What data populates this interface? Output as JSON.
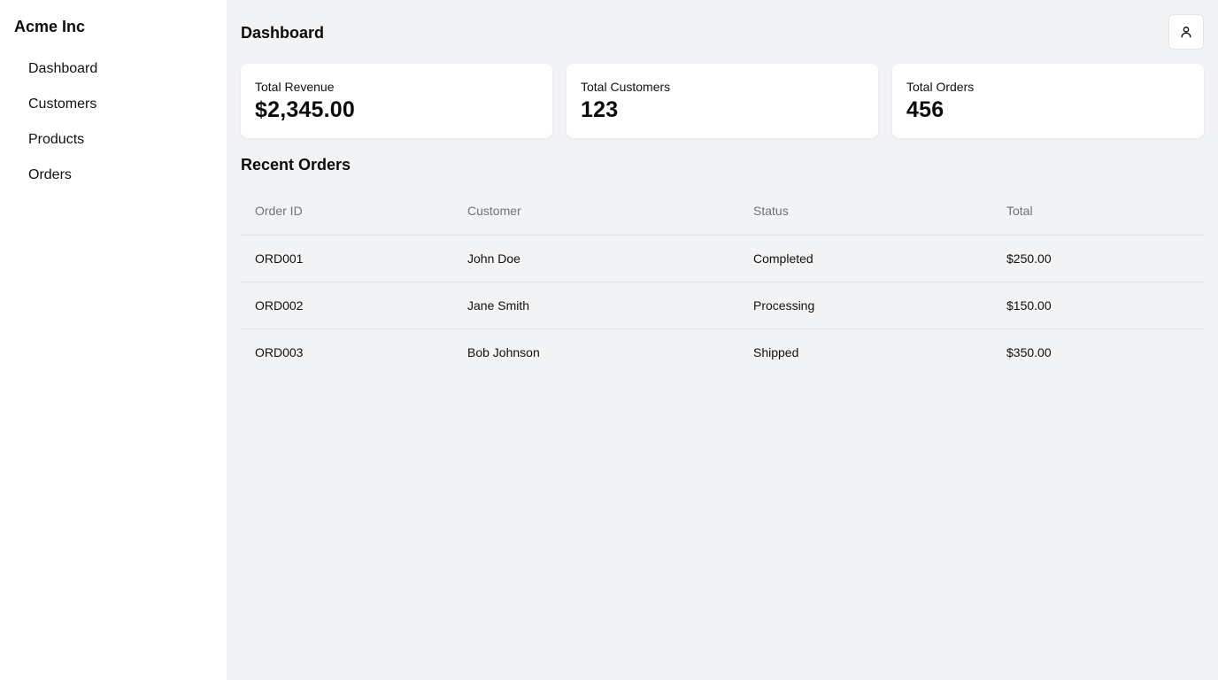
{
  "sidebar": {
    "brand": "Acme Inc",
    "items": [
      {
        "label": "Dashboard"
      },
      {
        "label": "Customers"
      },
      {
        "label": "Products"
      },
      {
        "label": "Orders"
      }
    ]
  },
  "header": {
    "title": "Dashboard",
    "user_icon": "user-icon"
  },
  "stats": [
    {
      "label": "Total Revenue",
      "value": "$2,345.00"
    },
    {
      "label": "Total Customers",
      "value": "123"
    },
    {
      "label": "Total Orders",
      "value": "456"
    }
  ],
  "recent_orders": {
    "title": "Recent Orders",
    "columns": [
      "Order ID",
      "Customer",
      "Status",
      "Total"
    ],
    "rows": [
      {
        "id": "ORD001",
        "customer": "John Doe",
        "status": "Completed",
        "total": "$250.00"
      },
      {
        "id": "ORD002",
        "customer": "Jane Smith",
        "status": "Processing",
        "total": "$150.00"
      },
      {
        "id": "ORD003",
        "customer": "Bob Johnson",
        "status": "Shipped",
        "total": "$350.00"
      }
    ]
  },
  "colors": {
    "background": "#f2f3f5",
    "surface": "#ffffff",
    "muted_text": "#6b7280",
    "text": "#111111"
  }
}
